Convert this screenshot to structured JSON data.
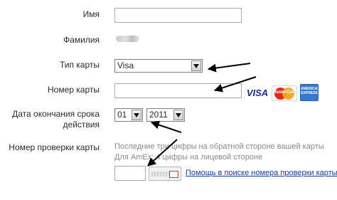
{
  "form": {
    "first_name_label": "Имя",
    "first_name_value": "",
    "last_name_label": "Фамилия",
    "card_type_label": "Тип карты",
    "card_type_selected": "Visa",
    "card_number_label": "Номер карты",
    "card_number_value": "",
    "expiry_label": "Дата окончания срока действия",
    "expiry_month_selected": "01",
    "expiry_year_selected": "2011",
    "cvv_label": "Номер проверки карты",
    "cvv_hint": "Последние три цифры на обратной стороне вашей карты Для AmEx: 4 цифры на лицевой стороне",
    "cvv_value": "",
    "cvv_help_link": "Помощь в поиске номера проверки карты"
  },
  "card_logos": {
    "visa_text": "VISA",
    "mastercard_text": "MasterCard",
    "amex_text": "AMERICAN EXPRESS"
  },
  "colors": {
    "link": "#1a3f8f",
    "hint_text": "#8a8a8a",
    "arrow": "#000000"
  }
}
